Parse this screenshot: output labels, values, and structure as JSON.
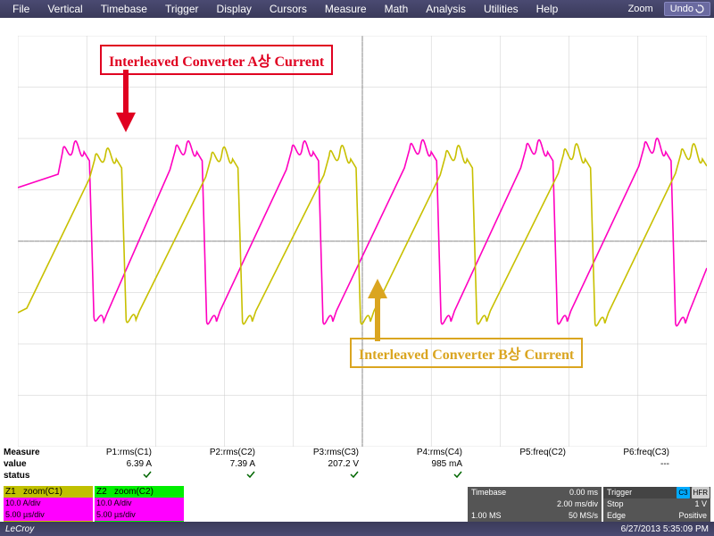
{
  "menu": {
    "items": [
      "File",
      "Vertical",
      "Timebase",
      "Trigger",
      "Display",
      "Cursors",
      "Measure",
      "Math",
      "Analysis",
      "Utilities",
      "Help"
    ],
    "zoom": "Zoom",
    "undo": "Undo"
  },
  "annotations": {
    "a": "Interleaved Converter A상 Current",
    "b": "Interleaved Converter B상 Current"
  },
  "measure": {
    "header": "Measure",
    "value_label": "value",
    "status_label": "status",
    "cols": [
      {
        "name": "P1:rms(C1)",
        "value": "6.39 A",
        "status": "✓"
      },
      {
        "name": "P2:rms(C2)",
        "value": "7.39 A",
        "status": "✓"
      },
      {
        "name": "P3:rms(C3)",
        "value": "207.2 V",
        "status": "✓"
      },
      {
        "name": "P4:rms(C4)",
        "value": "985 mA",
        "status": "✓"
      },
      {
        "name": "P5:freq(C2)",
        "value": "",
        "status": ""
      },
      {
        "name": "P6:freq(C3)",
        "value": "---",
        "status": ""
      }
    ]
  },
  "channels": {
    "z1": {
      "label": "Z1",
      "src": "zoom(C1)",
      "vdiv": "10.0 A/div",
      "tdiv": "5.00 µs/div"
    },
    "z2": {
      "label": "Z2",
      "src": "zoom(C2)",
      "vdiv": "10.0 A/div",
      "tdiv": "5.00 µs/div"
    }
  },
  "timebase": {
    "title": "Timebase",
    "delay": "0.00 ms",
    "tdiv": "2.00 ms/div",
    "record": "1.00 MS",
    "rate": "50 MS/s"
  },
  "trigger": {
    "title": "Trigger",
    "src": "C3",
    "mode": "HFR",
    "state": "Stop",
    "level": "1 V",
    "edge": "Edge",
    "slope": "Positive"
  },
  "footer": {
    "brand": "LeCroy",
    "datetime": "6/27/2013 5:35:09 PM"
  },
  "chart_data": {
    "type": "line",
    "title": "Oscilloscope zoom traces Z1/Z2 (interleaved converter phase currents)",
    "x_divisions": 10,
    "y_divisions": 8,
    "x_scale_per_div": "5.00 µs",
    "y_scale_per_div": "10.0 A",
    "y_center_div": 4,
    "series": [
      {
        "name": "Interleaved Converter A상 Current (Z1, C1, rms 6.39 A)",
        "color": "#c8c000",
        "shape": "periodic sawtooth; ramps up ~1.2 div, spike/ringing burst at ~+1.6 div peak (~16 A), then falls near-vertically to ~-1.6 div (~-16 A), slow ramp back; ~5.5 cycles across screen, period ≈ 1.8 x-div ≈ 9 µs",
        "approx_phase_offset_div": 0
      },
      {
        "name": "Interleaved Converter B상 Current (Z2, C2, rms 7.39 A)",
        "color": "#ff00c0",
        "shape": "same sawtooth shape as A but phase-shifted ~0.9 x-div (≈180°); peaks ~+1.7 div (~17 A), troughs ~-1.6 div",
        "approx_phase_offset_div": 0.9
      }
    ]
  }
}
